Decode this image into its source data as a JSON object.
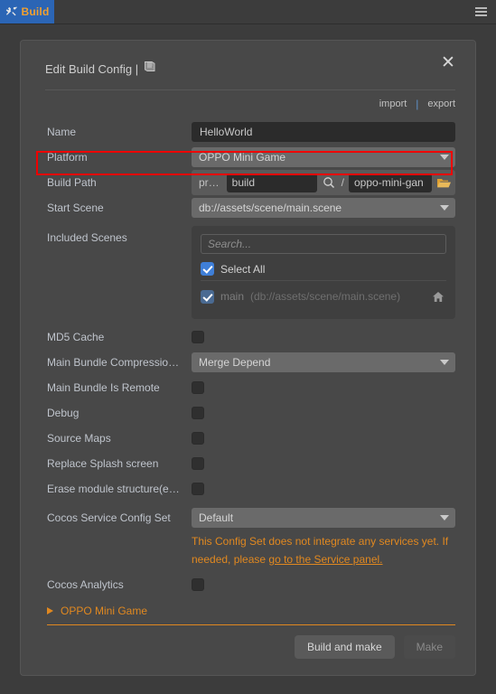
{
  "tabbar": {
    "tab_label": "Build",
    "tab_icon": "tools-icon",
    "menu_icon": "hamburger-menu-icon",
    "accent_blue": "#2b65b5",
    "accent_orange": "#f0a030"
  },
  "dialog": {
    "title": "Edit Build Config |",
    "doc_icon": "book-icon",
    "close_label": "✕",
    "import_label": "import",
    "export_label": "export",
    "separator": "|"
  },
  "form": {
    "name": {
      "label": "Name",
      "value": "HelloWorld"
    },
    "platform": {
      "label": "Platform",
      "value": "OPPO Mini Game"
    },
    "build_path": {
      "label": "Build Path",
      "prefix": "pr…",
      "folder_value": "build",
      "search_icon": "magnifier-icon",
      "slash": "/",
      "sub_value": "oppo-mini-gan",
      "browse_icon": "folder-open-icon"
    },
    "start_scene": {
      "label": "Start Scene",
      "value": "db://assets/scene/main.scene"
    },
    "included_scenes": {
      "label": "Included Scenes",
      "search_placeholder": "Search...",
      "search_value": "",
      "select_all_label": "Select All",
      "select_all_checked": true,
      "items": [
        {
          "name": "main",
          "path": "(db://assets/scene/main.scene)",
          "checked": true,
          "disabled": true,
          "home_icon": "home-icon"
        }
      ]
    },
    "md5_cache": {
      "label": "MD5 Cache",
      "checked": false
    },
    "main_bundle_compression": {
      "label": "Main Bundle Compressio…",
      "value": "Merge Depend"
    },
    "main_bundle_is_remote": {
      "label": "Main Bundle Is Remote",
      "checked": false
    },
    "debug": {
      "label": "Debug",
      "checked": false
    },
    "source_maps": {
      "label": "Source Maps",
      "checked": false
    },
    "replace_splash": {
      "label": "Replace Splash screen",
      "checked": false
    },
    "erase_module": {
      "label": "Erase module structure(e…",
      "checked": false
    },
    "cocos_service_config": {
      "label": "Cocos Service Config Set",
      "value": "Default"
    },
    "service_warning": {
      "text_before": "This Config Set does not integrate any services yet. If needed, please ",
      "link_text": "go to the Service panel.",
      "color": "#e08820"
    },
    "cocos_analytics": {
      "label": "Cocos Analytics",
      "checked": false
    },
    "platform_section": {
      "label": "OPPO Mini Game",
      "expanded": false,
      "arrow_icon": "triangle-right-icon"
    }
  },
  "footer": {
    "build_and_make": "Build and make",
    "make": "Make"
  },
  "highlight": {
    "color": "#f00000",
    "target": "platform-row"
  }
}
